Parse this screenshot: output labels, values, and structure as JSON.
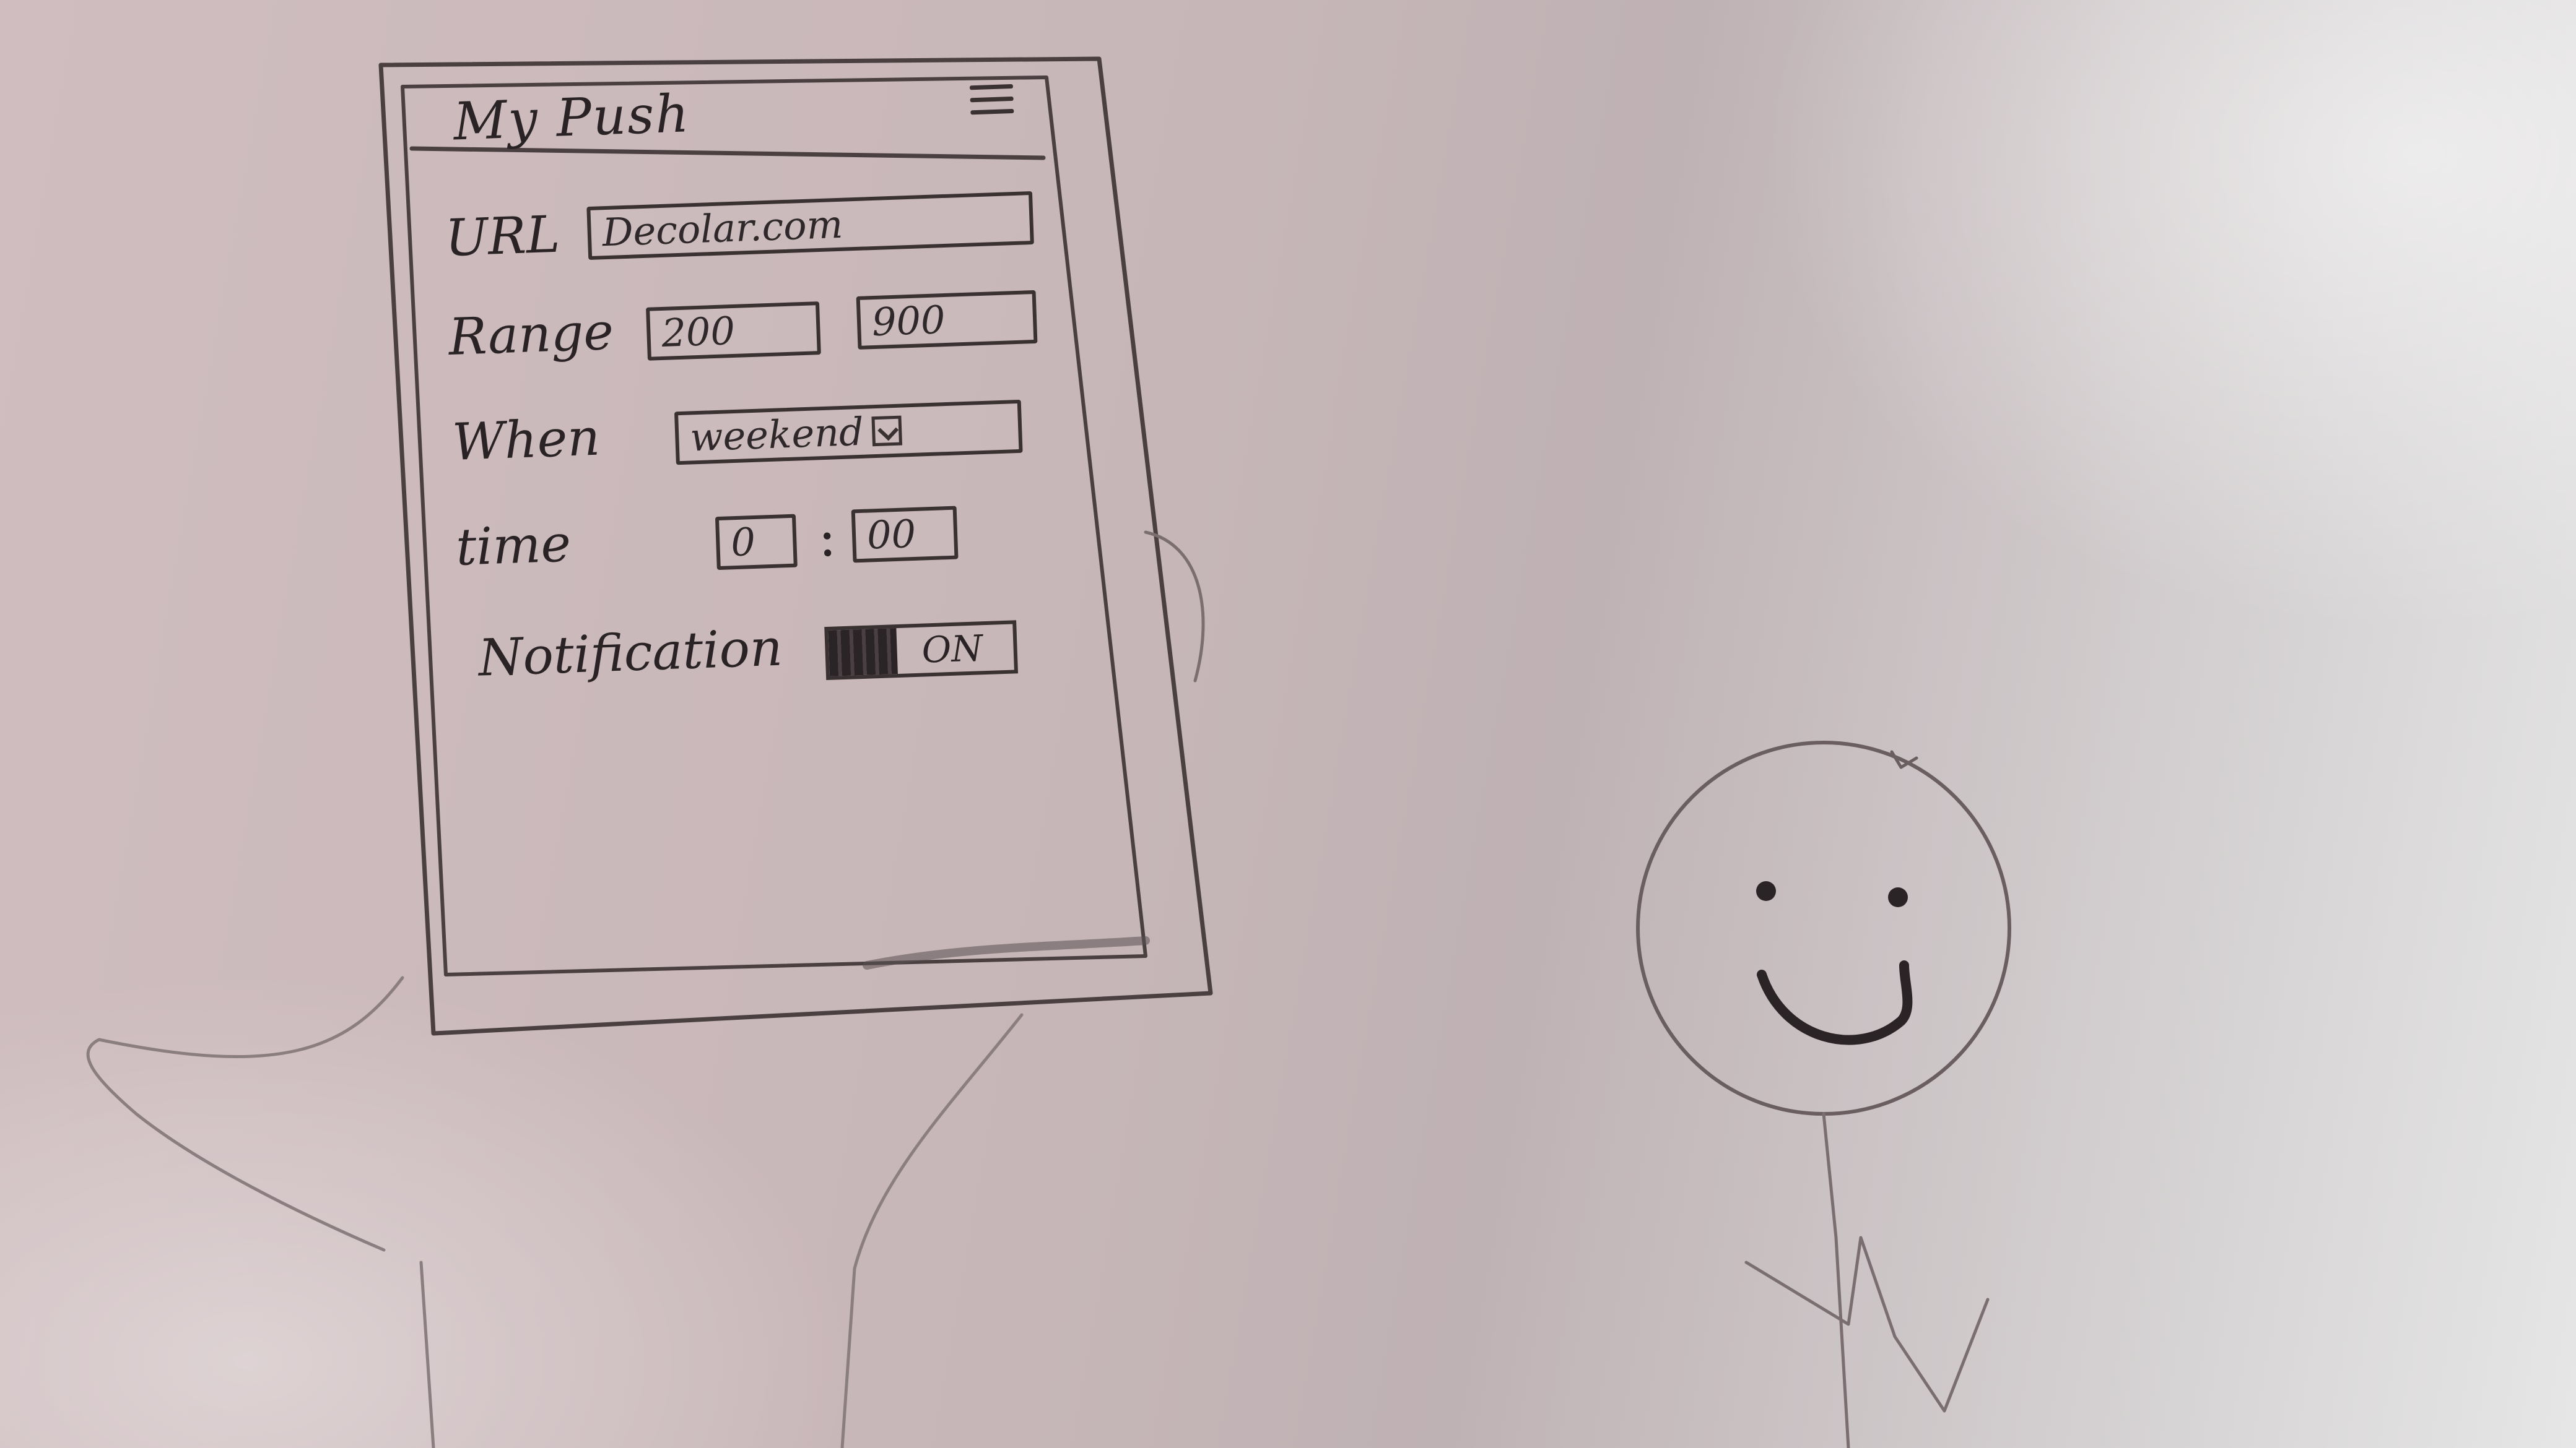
{
  "app": {
    "title": "My Push"
  },
  "form": {
    "url": {
      "label": "URL",
      "value": "Decolar.com"
    },
    "range": {
      "label": "Range",
      "min": "200",
      "max": "900"
    },
    "when": {
      "label": "When",
      "selected": "weekend"
    },
    "time": {
      "label": "time",
      "hour": "0",
      "minute": "00"
    },
    "notification": {
      "label": "Notification",
      "state": "ON"
    }
  },
  "colors": {
    "pencil": "#3a3133",
    "paper": "#cdbcbd"
  }
}
